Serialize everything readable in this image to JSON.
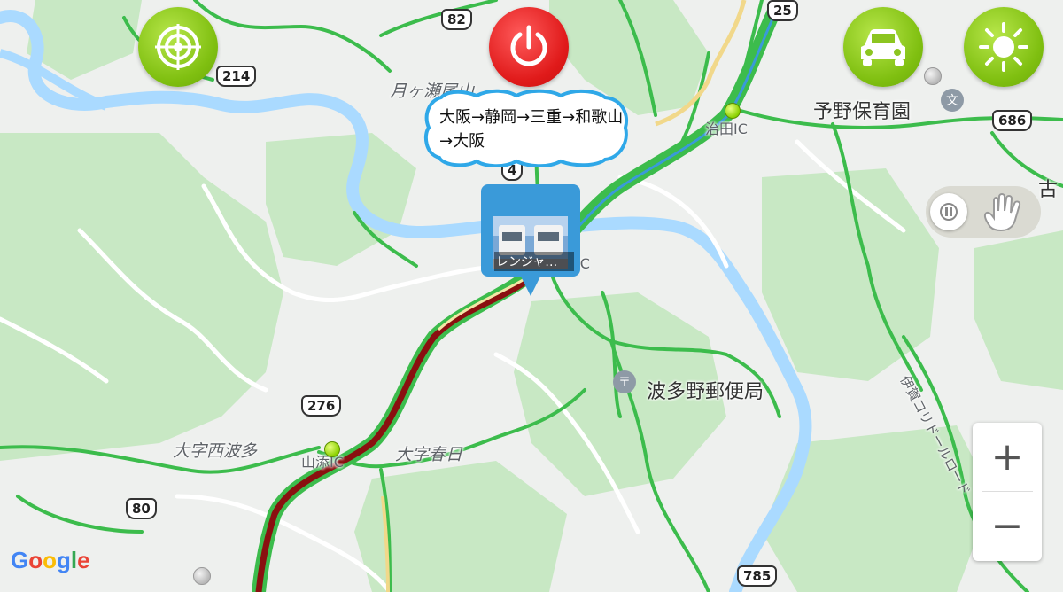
{
  "map": {
    "place_labels": {
      "tsukigase": "月ヶ瀬尾山",
      "yano_nursery": "予野保育園",
      "hatano_post": "波多野郵便局",
      "nishihata": "大字西波多",
      "kasuga": "大字春日",
      "ic_top_right": "治田IC",
      "ic_center": "IC",
      "ic_left": "山添IC",
      "ko_edge": "古",
      "iga_road": "伊賀コリドールロード"
    },
    "route_shields": {
      "r82": "82",
      "r214": "214",
      "r25": "25",
      "r686": "686",
      "r4": "4",
      "r276": "276",
      "r80": "80",
      "r785": "785"
    },
    "colors": {
      "water": "#aadaff",
      "land": "#eef0ee",
      "forest": "#c8e8c4",
      "road_green": "#3cbc4c",
      "road_red_dark": "#8a1010",
      "highway_blue": "#3a9ad9"
    }
  },
  "controls": {
    "target_button_icon": "target-icon",
    "power_button_icon": "power-icon",
    "car_button_icon": "car-icon",
    "brightness_button_icon": "sun-icon",
    "toggle_pause_icon": "pause-icon",
    "toggle_hand_icon": "hand-icon",
    "zoom_in_label": "+",
    "zoom_out_label": "−"
  },
  "route_bubble": {
    "text": "大阪→静岡→三重→和歌山→大阪"
  },
  "vehicle_marker": {
    "caption": "レンジャ…"
  },
  "attribution": {
    "logo_text": "Google"
  }
}
